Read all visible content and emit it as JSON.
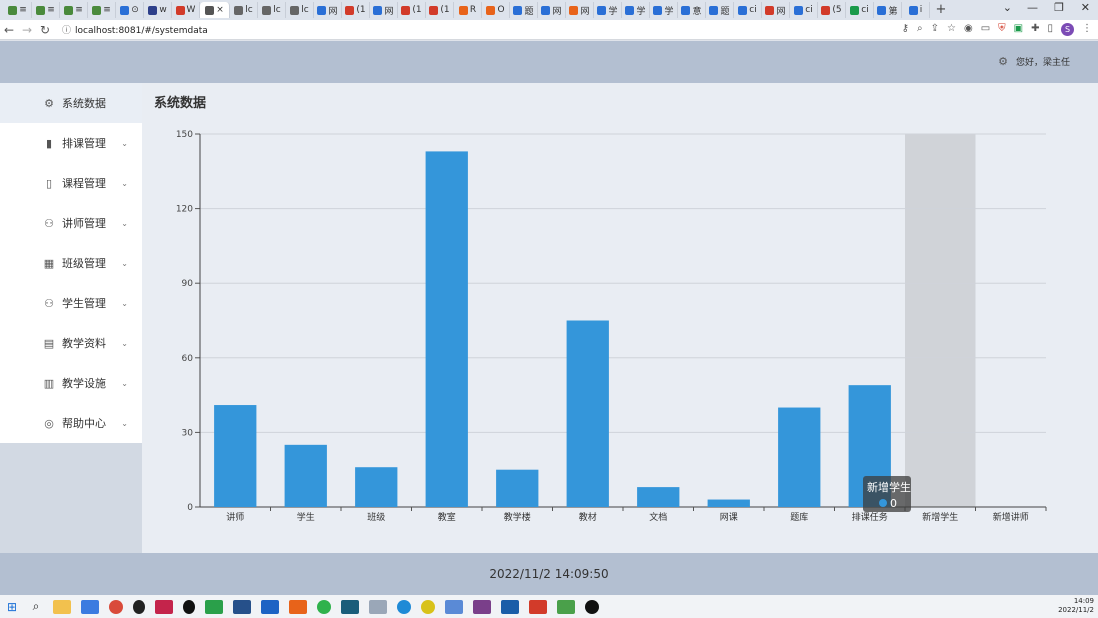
{
  "browser": {
    "tabs": [
      {
        "label": "≡",
        "color": "#4a8a3c"
      },
      {
        "label": "≡",
        "color": "#4a8a3c"
      },
      {
        "label": "≡",
        "color": "#4a8a3c"
      },
      {
        "label": "≡",
        "color": "#4a8a3c"
      },
      {
        "label": "⊙",
        "color": "#2a6fd6"
      },
      {
        "label": "w",
        "color": "#2d3f8a"
      },
      {
        "label": "W",
        "color": "#d23b2a"
      },
      {
        "label": "×",
        "color": "#555555"
      },
      {
        "label": "lc",
        "color": "#666666"
      },
      {
        "label": "lc",
        "color": "#666666"
      },
      {
        "label": "lc",
        "color": "#666666"
      },
      {
        "label": "网",
        "color": "#2a6fd6"
      },
      {
        "label": "(1",
        "color": "#d23b2a"
      },
      {
        "label": "网",
        "color": "#2a6fd6"
      },
      {
        "label": "(1",
        "color": "#d23b2a"
      },
      {
        "label": "(1",
        "color": "#d23b2a"
      },
      {
        "label": "R",
        "color": "#e8631a"
      },
      {
        "label": "O",
        "color": "#e8631a"
      },
      {
        "label": "题",
        "color": "#2a6fd6"
      },
      {
        "label": "网",
        "color": "#2a6fd6"
      },
      {
        "label": "网",
        "color": "#e8631a"
      },
      {
        "label": "学",
        "color": "#2a6fd6"
      },
      {
        "label": "学",
        "color": "#2a6fd6"
      },
      {
        "label": "学",
        "color": "#2a6fd6"
      },
      {
        "label": "意",
        "color": "#2a6fd6"
      },
      {
        "label": "题",
        "color": "#2a6fd6"
      },
      {
        "label": "ci",
        "color": "#2a6fd6"
      },
      {
        "label": "网",
        "color": "#d23b2a"
      },
      {
        "label": "ci",
        "color": "#2a6fd6"
      },
      {
        "label": "(5",
        "color": "#d23b2a"
      },
      {
        "label": "ci",
        "color": "#1a9a4a"
      },
      {
        "label": "第",
        "color": "#2a6fd6"
      },
      {
        "label": "i",
        "color": "#2a6fd6"
      }
    ],
    "new_tab": "+",
    "window_controls": [
      "⌄",
      "—",
      "❐",
      "✕"
    ],
    "url": "localhost:8081/#/systemdata",
    "profile_initial": "S"
  },
  "header": {
    "greeting": "您好，梁主任"
  },
  "sidebar": {
    "items": [
      {
        "label": "系统数据",
        "icon": "gear-icon"
      },
      {
        "label": "排课管理",
        "icon": "bar-chart-icon"
      },
      {
        "label": "课程管理",
        "icon": "book-icon"
      },
      {
        "label": "讲师管理",
        "icon": "user-icon"
      },
      {
        "label": "班级管理",
        "icon": "calendar-icon"
      },
      {
        "label": "学生管理",
        "icon": "user-icon"
      },
      {
        "label": "教学资料",
        "icon": "document-icon"
      },
      {
        "label": "教学设施",
        "icon": "building-icon"
      },
      {
        "label": "帮助中心",
        "icon": "help-icon"
      }
    ]
  },
  "main": {
    "title": "系统数据"
  },
  "chart_data": {
    "type": "bar",
    "categories": [
      "讲师",
      "学生",
      "班级",
      "教室",
      "教学楼",
      "教材",
      "文档",
      "网课",
      "题库",
      "排课任务",
      "新增学生",
      "新增讲师"
    ],
    "values": [
      41,
      25,
      16,
      143,
      15,
      75,
      8,
      3,
      40,
      49,
      0,
      0
    ],
    "ylim": [
      0,
      150
    ],
    "yticks": [
      0,
      30,
      60,
      90,
      120,
      150
    ],
    "color": "#3496da",
    "highlighted_category": "新增学生",
    "tooltip": {
      "category": "新增学生",
      "value": "0"
    }
  },
  "footer": {
    "datetime": "2022/11/2 14:09:50"
  },
  "taskbar": {
    "tray_time": "14:09",
    "tray_date": "2022/11/2"
  }
}
